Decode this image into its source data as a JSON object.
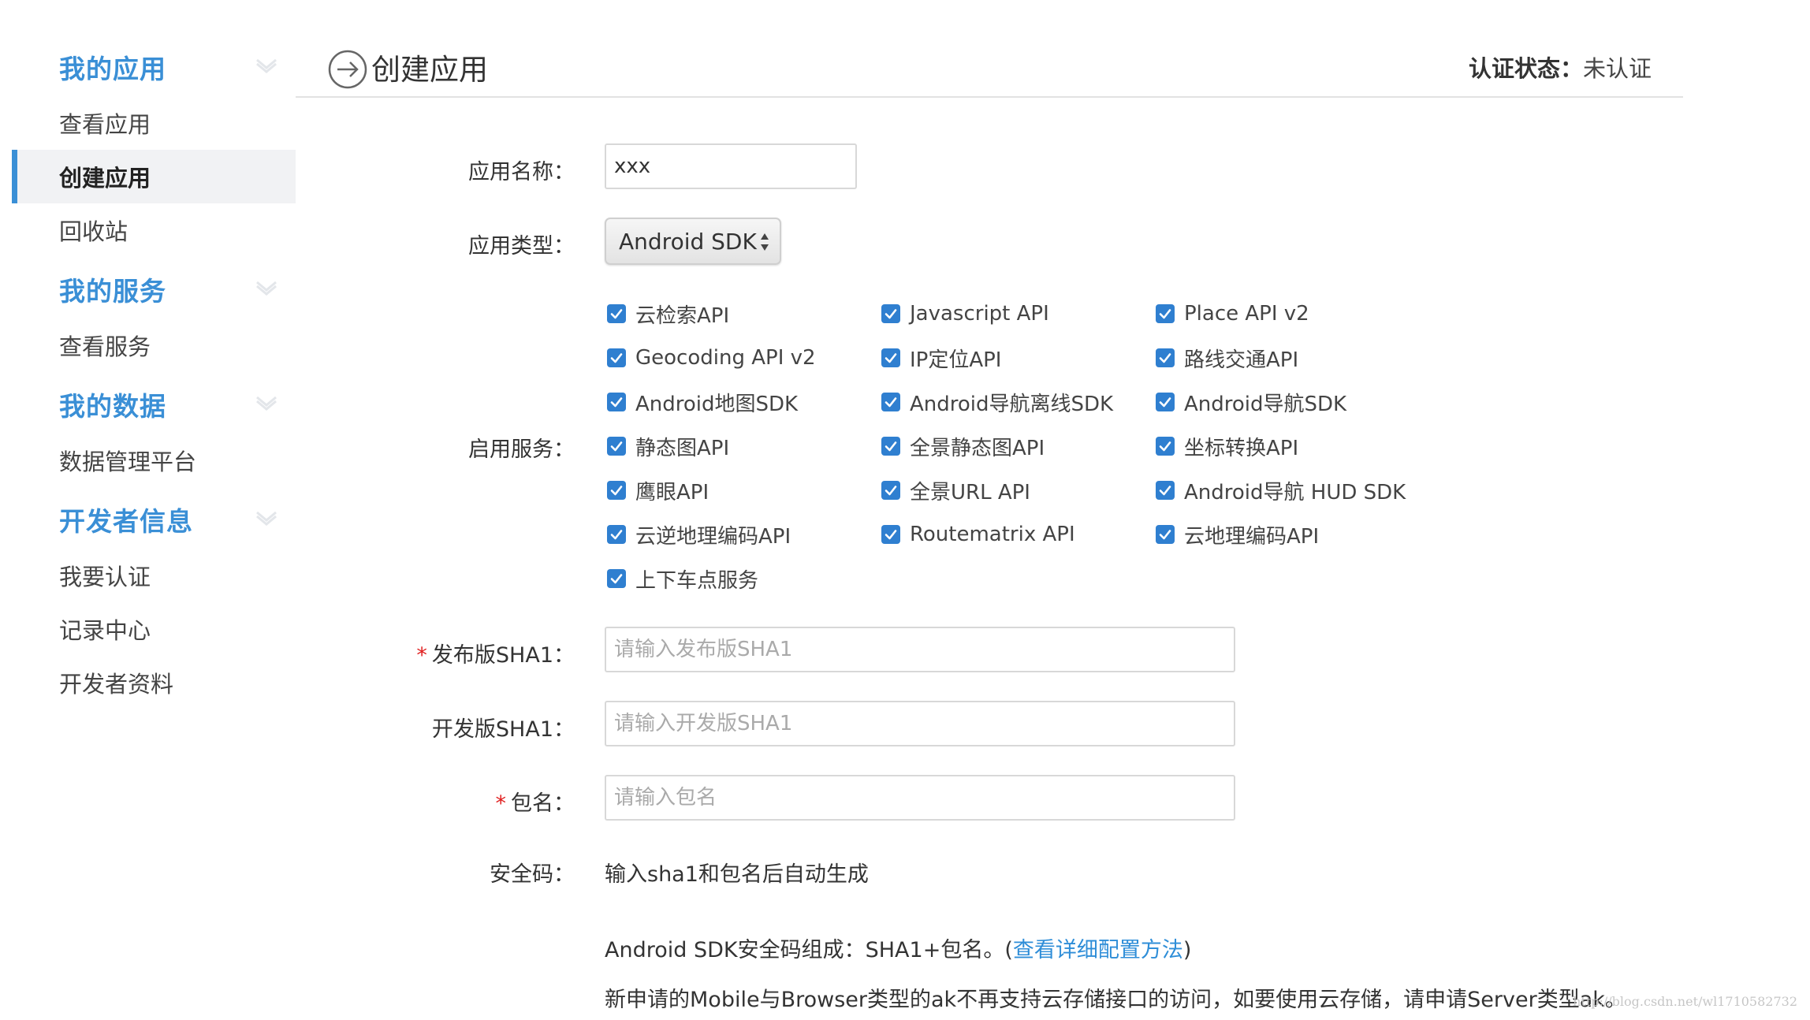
{
  "sidebar": {
    "sections": [
      {
        "title": "我的应用",
        "items": [
          "查看应用",
          "创建应用",
          "回收站"
        ]
      },
      {
        "title": "我的服务",
        "items": [
          "查看服务"
        ]
      },
      {
        "title": "我的数据",
        "items": [
          "数据管理平台"
        ]
      },
      {
        "title": "开发者信息",
        "items": [
          "我要认证",
          "记录中心",
          "开发者资料"
        ]
      }
    ],
    "active_item": "创建应用"
  },
  "header": {
    "title": "创建应用",
    "auth_label": "认证状态：",
    "auth_value": "未认证"
  },
  "form": {
    "app_name": {
      "label": "应用名称：",
      "value": "xxx"
    },
    "app_type": {
      "label": "应用类型：",
      "value": "Android SDK"
    },
    "services": {
      "label": "启用服务：",
      "items": [
        {
          "label": "云检索API",
          "checked": true
        },
        {
          "label": "Javascript API",
          "checked": true
        },
        {
          "label": "Place API v2",
          "checked": true
        },
        {
          "label": "Geocoding API v2",
          "checked": true
        },
        {
          "label": "IP定位API",
          "checked": true
        },
        {
          "label": "路线交通API",
          "checked": true
        },
        {
          "label": "Android地图SDK",
          "checked": true
        },
        {
          "label": "Android导航离线SDK",
          "checked": true
        },
        {
          "label": "Android导航SDK",
          "checked": true
        },
        {
          "label": "静态图API",
          "checked": true
        },
        {
          "label": "全景静态图API",
          "checked": true
        },
        {
          "label": "坐标转换API",
          "checked": true
        },
        {
          "label": "鹰眼API",
          "checked": true
        },
        {
          "label": "全景URL API",
          "checked": true
        },
        {
          "label": "Android导航 HUD SDK",
          "checked": true
        },
        {
          "label": "云逆地理编码API",
          "checked": true
        },
        {
          "label": "Routematrix API",
          "checked": true
        },
        {
          "label": "云地理编码API",
          "checked": true
        },
        {
          "label": "上下车点服务",
          "checked": true
        }
      ]
    },
    "release_sha1": {
      "required_mark": "*",
      "label": "发布版SHA1：",
      "value": "",
      "placeholder": "请输入发布版SHA1"
    },
    "dev_sha1": {
      "label": "开发版SHA1：",
      "value": "",
      "placeholder": "请输入开发版SHA1"
    },
    "package_name": {
      "required_mark": "*",
      "label": "包名：",
      "value": "",
      "placeholder": "请输入包名"
    },
    "security_code": {
      "label": "安全码：",
      "value": "输入sha1和包名后自动生成"
    }
  },
  "notes": {
    "line1_prefix": "Android SDK安全码组成：SHA1+包名。(",
    "line1_link": "查看详细配置方法",
    "line1_suffix": ")",
    "line2": "新申请的Mobile与Browser类型的ak不再支持云存储接口的访问，如要使用云存储，请申请Server类型ak。"
  },
  "watermark": "http://blog.csdn.net/wl1710582732",
  "colors": {
    "accent": "#3a8fd6",
    "link": "#2f8ed8",
    "checkbox": "#2f7fd0",
    "required": "#e02020"
  }
}
